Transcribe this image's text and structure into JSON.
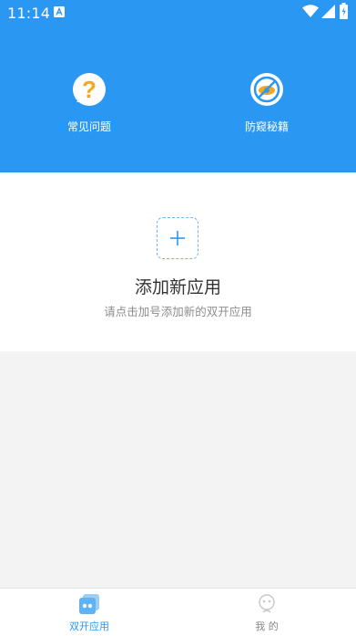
{
  "status_bar": {
    "time": "11:14",
    "icons": [
      "notification-a-icon",
      "wifi-icon",
      "signal-icon",
      "battery-icon"
    ]
  },
  "header": {
    "background_color": "#2a98f2",
    "shortcuts": [
      {
        "label": "常见问题",
        "icon": "question-icon",
        "icon_color": "#f5a623"
      },
      {
        "label": "防窥秘籍",
        "icon": "no-peek-icon",
        "icon_color": "#2a98f2"
      }
    ]
  },
  "add_app": {
    "icon": "plus-icon",
    "title": "添加新应用",
    "subtitle": "请点击加号添加新的双开应用"
  },
  "tab_bar": {
    "active_color": "#2a98f2",
    "tabs": [
      {
        "label": "双开应用",
        "icon": "dual-apps-icon",
        "active": true
      },
      {
        "label": "我 的",
        "icon": "profile-icon",
        "active": false
      }
    ]
  }
}
